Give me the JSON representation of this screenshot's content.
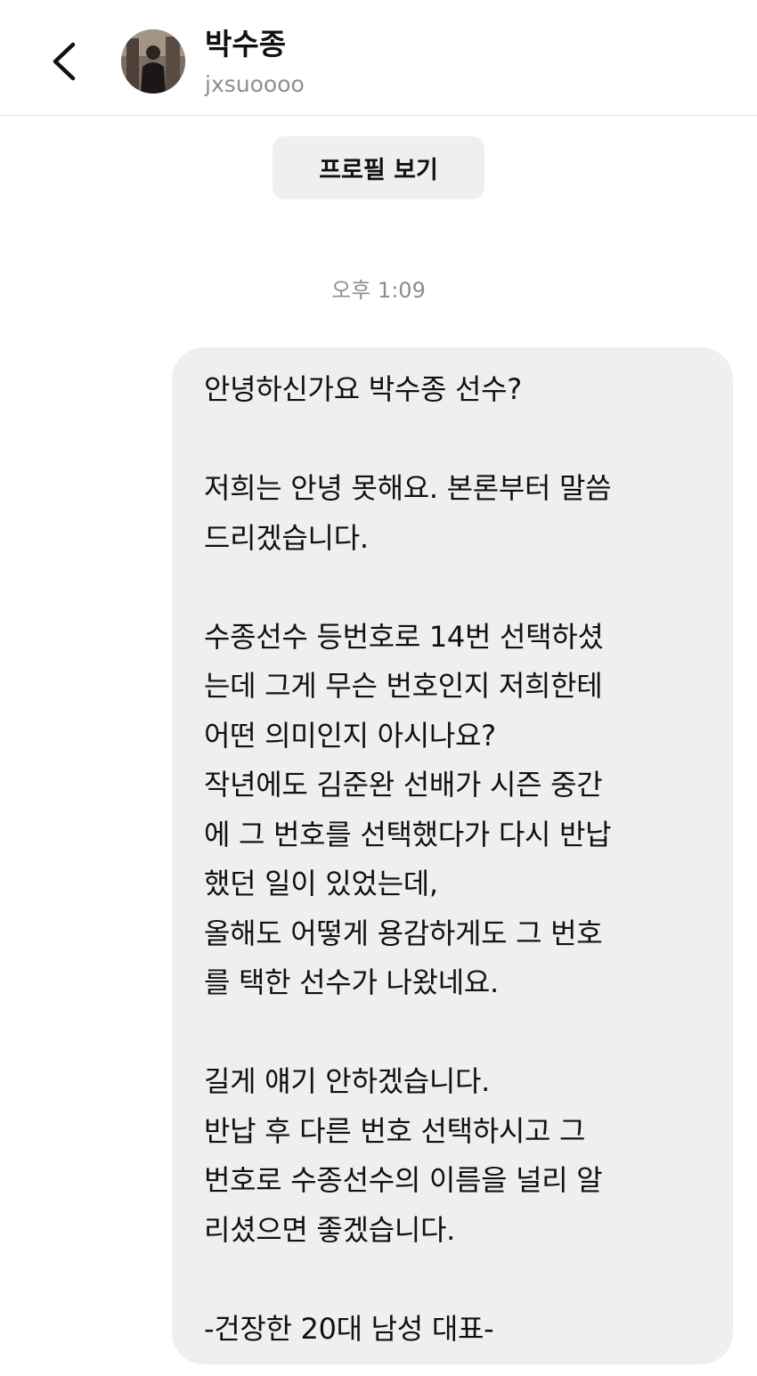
{
  "header": {
    "display_name": "박수종",
    "username": "jxsuoooo",
    "back_icon": "chevron-left-icon"
  },
  "profile_button": {
    "label": "프로필 보기"
  },
  "timestamp": "오후 1:09",
  "message": {
    "lines": [
      "안녕하신가요 박수종 선수?",
      "",
      "저희는 안녕 못해요. 본론부터 말씀",
      "드리겠습니다.",
      "",
      "수종선수 등번호로 14번 선택하셨",
      "는데 그게 무슨 번호인지 저희한테",
      "어떤 의미인지 아시나요?",
      "작년에도 김준완 선배가 시즌 중간",
      "에 그 번호를 선택했다가 다시 반납",
      "했던 일이 있었는데,",
      "올해도 어떻게 용감하게도 그 번호",
      "를 택한 선수가 나왔네요.",
      "",
      "길게 얘기 안하겠습니다.",
      "반납 후 다른 번호 선택하시고 그",
      "번호로 수종선수의 이름을 널리 알",
      "리셨으면 좋겠습니다.",
      "",
      "-건장한 20대 남성 대표-"
    ]
  },
  "colors": {
    "bubble_bg": "#efefef",
    "button_bg": "#efefef",
    "secondary_text": "#8e8e8e",
    "primary_text": "#111111",
    "divider": "#e6e6e6"
  }
}
